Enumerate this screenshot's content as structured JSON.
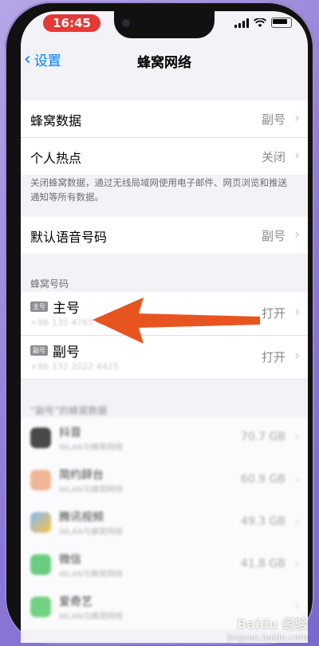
{
  "status": {
    "time": "16:45"
  },
  "nav": {
    "back_label": "设置",
    "title": "蜂窝网络"
  },
  "group1": [
    {
      "label": "蜂窝数据",
      "value": "副号"
    },
    {
      "label": "个人热点",
      "value": "关闭"
    }
  ],
  "note": "关闭蜂窝数据，通过无线局域网使用电子邮件、网页浏览和推送通知等所有数据。",
  "group2": [
    {
      "label": "默认语音号码",
      "value": "副号"
    }
  ],
  "sims_header": "蜂窝号码",
  "sims": [
    {
      "badge": "主号",
      "name": "主号",
      "number": "+86 135 4765 4321",
      "value": "打开"
    },
    {
      "badge": "副号",
      "name": "副号",
      "number": "+86 132 2022 4425",
      "value": "打开"
    }
  ],
  "apps_header": "“副号”的蜂窝数据",
  "apps": [
    {
      "name": "抖音",
      "sub": "WLAN与蜂窝网络",
      "value": "70.7 GB",
      "color": "#111111"
    },
    {
      "name": "简约辞台",
      "sub": "WLAN与蜂窝网络",
      "value": "60.9 GB",
      "color": "#f0a078"
    },
    {
      "name": "腾讯视频",
      "sub": "WLAN与蜂窝网络",
      "value": "49.3 GB",
      "color": "#5aa6ff"
    },
    {
      "name": "微信",
      "sub": "WLAN与蜂窝网络",
      "value": "41.8 GB",
      "color": "#3cc15a"
    },
    {
      "name": "爱奇艺",
      "sub": "WLAN与蜂窝网络",
      "value": "",
      "color": "#48c85a"
    }
  ],
  "watermark": {
    "logo": "Baidu 经验",
    "url": "jingyan.baidu.com"
  },
  "colors": {
    "accent": "#007aff",
    "arrow": "#e8541f",
    "time_pill": "#e53935"
  }
}
